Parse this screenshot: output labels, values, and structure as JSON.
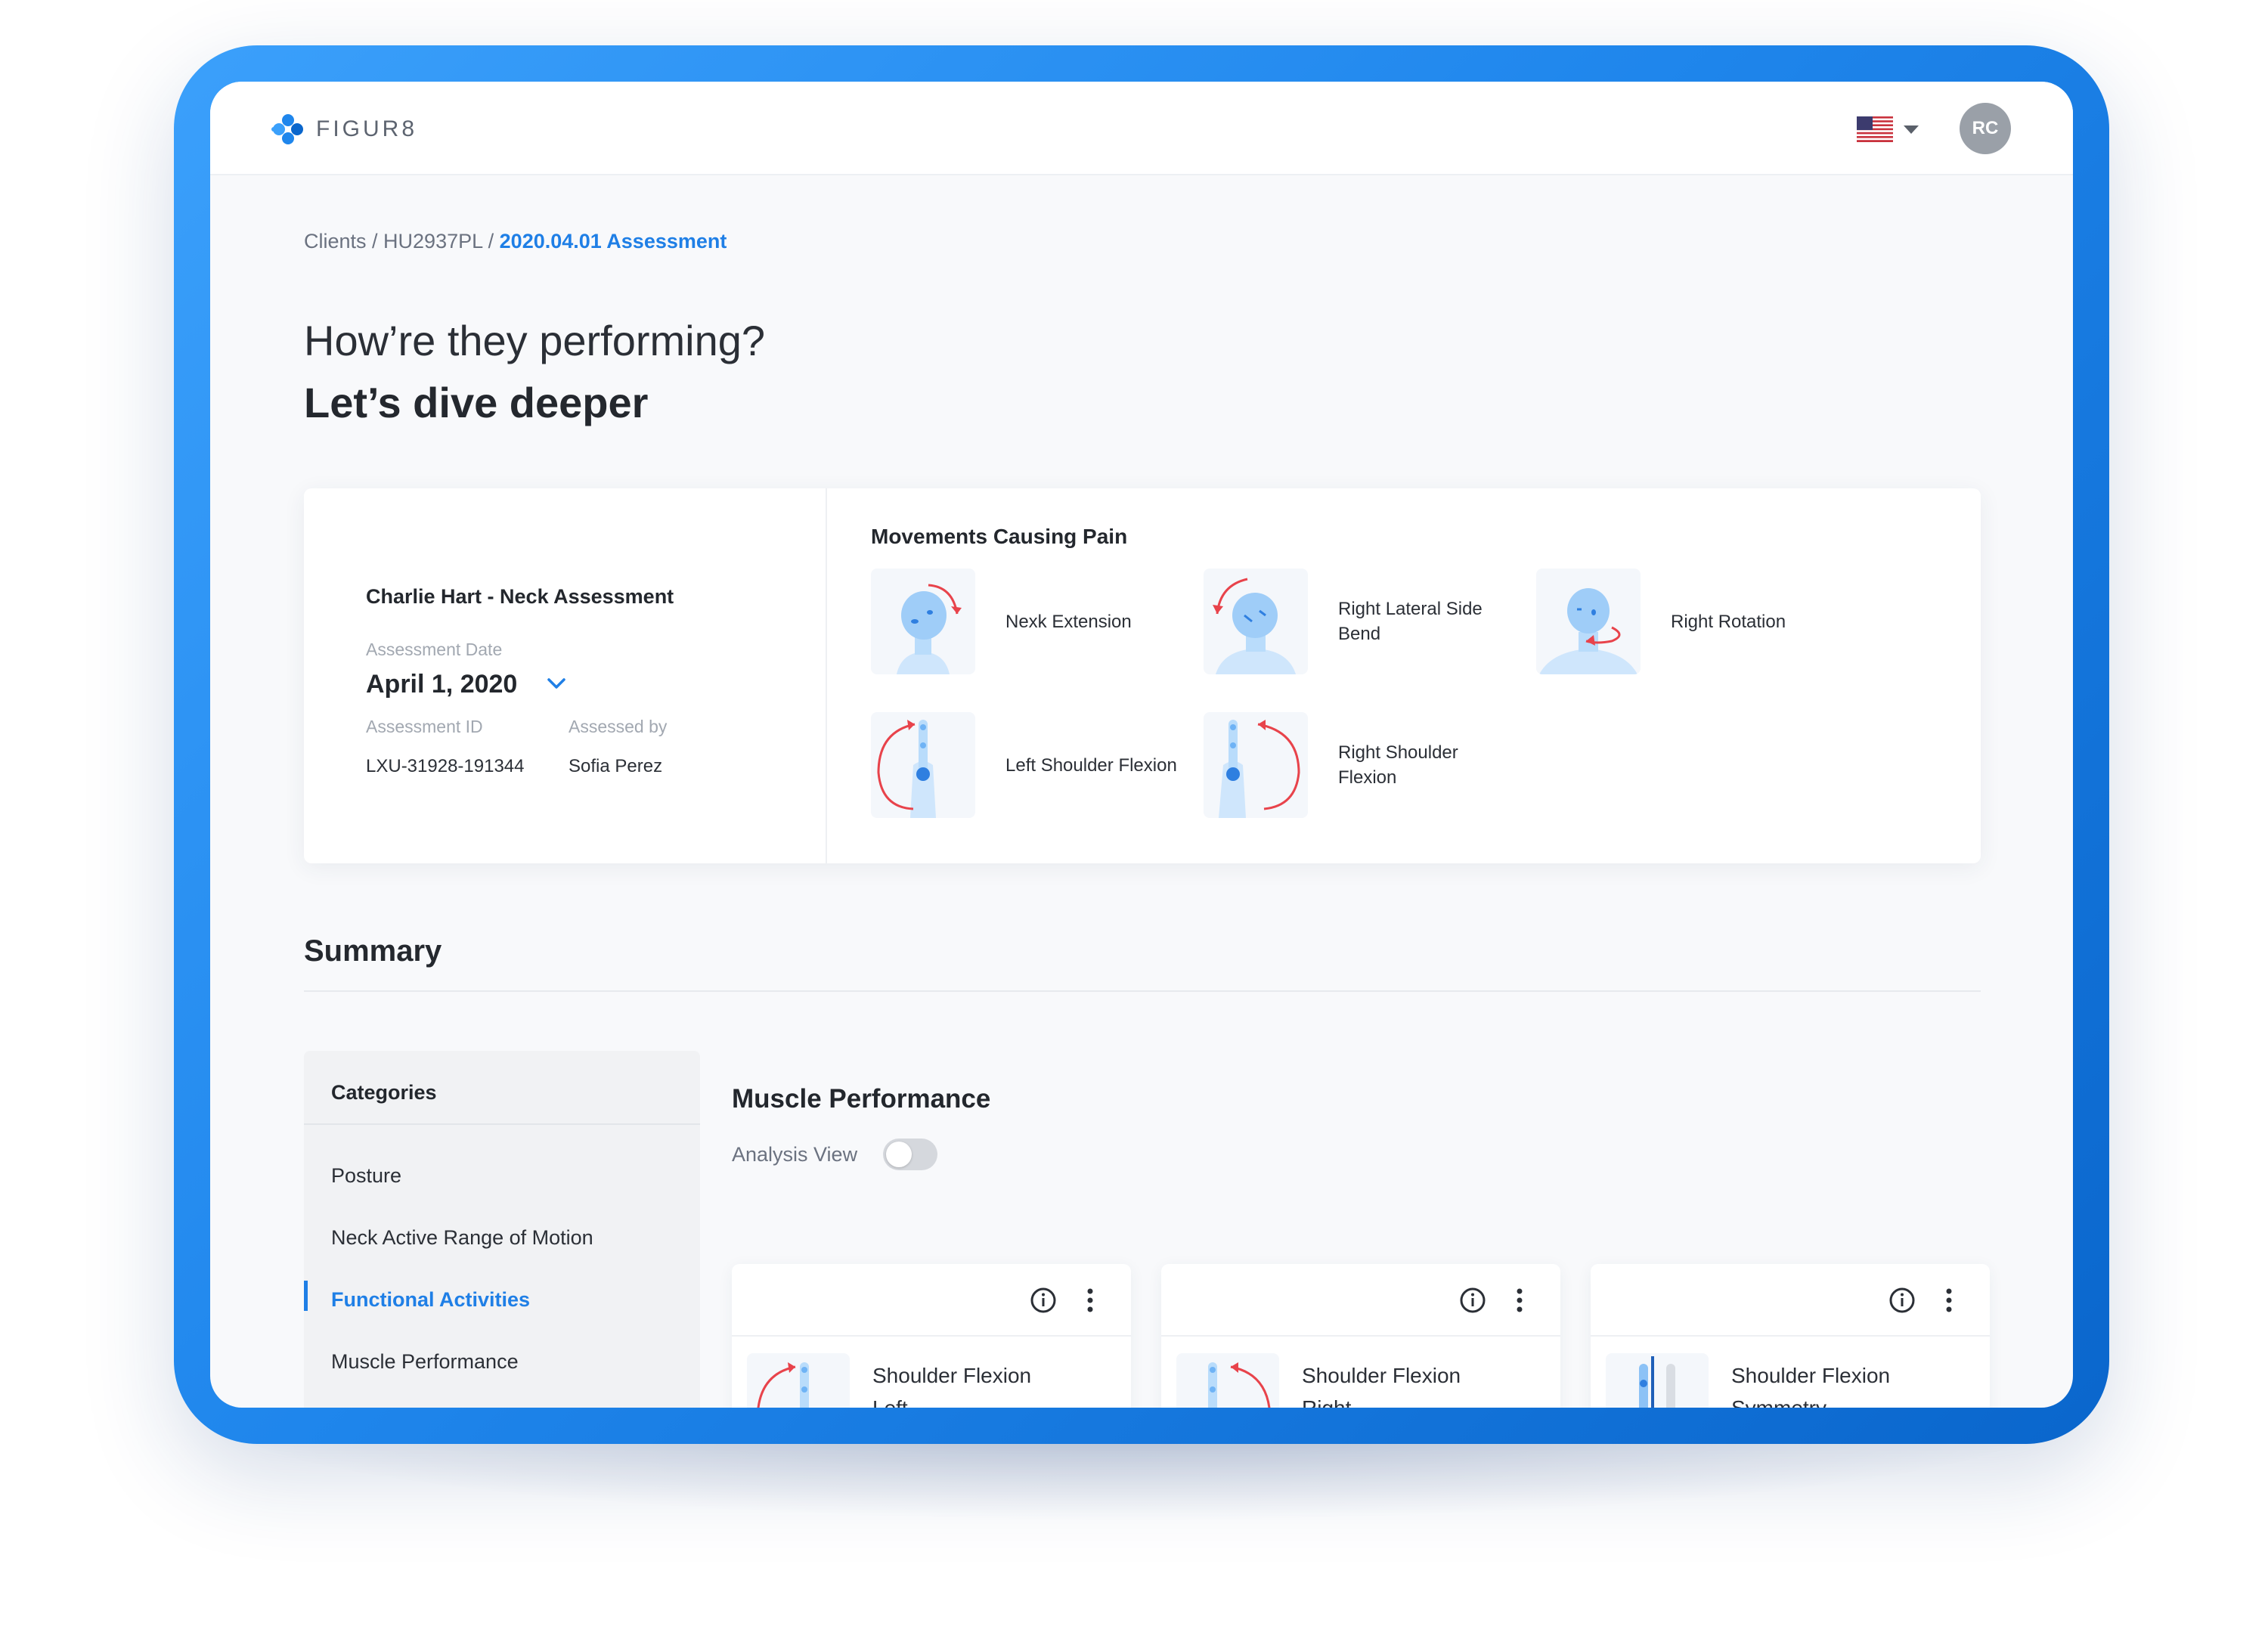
{
  "app": {
    "logo_text": "FIGUR8"
  },
  "header": {
    "avatar_initials": "RC"
  },
  "breadcrumb": {
    "items": [
      "Clients",
      "HU2937PL"
    ],
    "separator": " / ",
    "current": "2020.04.01 Assessment"
  },
  "hero": {
    "subtitle": "How’re they performing?",
    "title": "Let’s dive deeper"
  },
  "assessment": {
    "name": "Charlie Hart - Neck Assessment",
    "date_label": "Assessment Date",
    "date_value": "April 1, 2020",
    "id_label": "Assessment ID",
    "id_value": "LXU-31928-191344",
    "assessor_label": "Assessed by",
    "assessor_value": "Sofia Perez"
  },
  "pain": {
    "title": "Movements Causing Pain",
    "movements": [
      {
        "label": "Nexk Extension"
      },
      {
        "label": "Right Lateral Side Bend"
      },
      {
        "label": "Right Rotation"
      },
      {
        "label": "Left Shoulder Flexion"
      },
      {
        "label": "Right Shoulder Flexion"
      }
    ]
  },
  "summary": {
    "title": "Summary",
    "categories_title": "Categories",
    "categories": [
      {
        "label": "Posture",
        "active": false
      },
      {
        "label": "Neck Active Range of Motion",
        "active": false
      },
      {
        "label": "Functional Activities",
        "active": true
      },
      {
        "label": "Muscle Performance",
        "active": false
      }
    ],
    "section_title": "Muscle Performance",
    "analysis_view_label": "Analysis View",
    "analysis_view_on": false,
    "cards": [
      {
        "title_line1": "Shoulder Flexion",
        "title_line2": "Left"
      },
      {
        "title_line1": "Shoulder Flexion",
        "title_line2": "Right"
      },
      {
        "title_line1": "Shoulder Flexion",
        "title_line2": "Symmetry"
      }
    ]
  },
  "colors": {
    "accent": "#1f7fe6",
    "pain": "#e8434b",
    "frame": "#1f86ec",
    "body": "#b9dcfb"
  }
}
